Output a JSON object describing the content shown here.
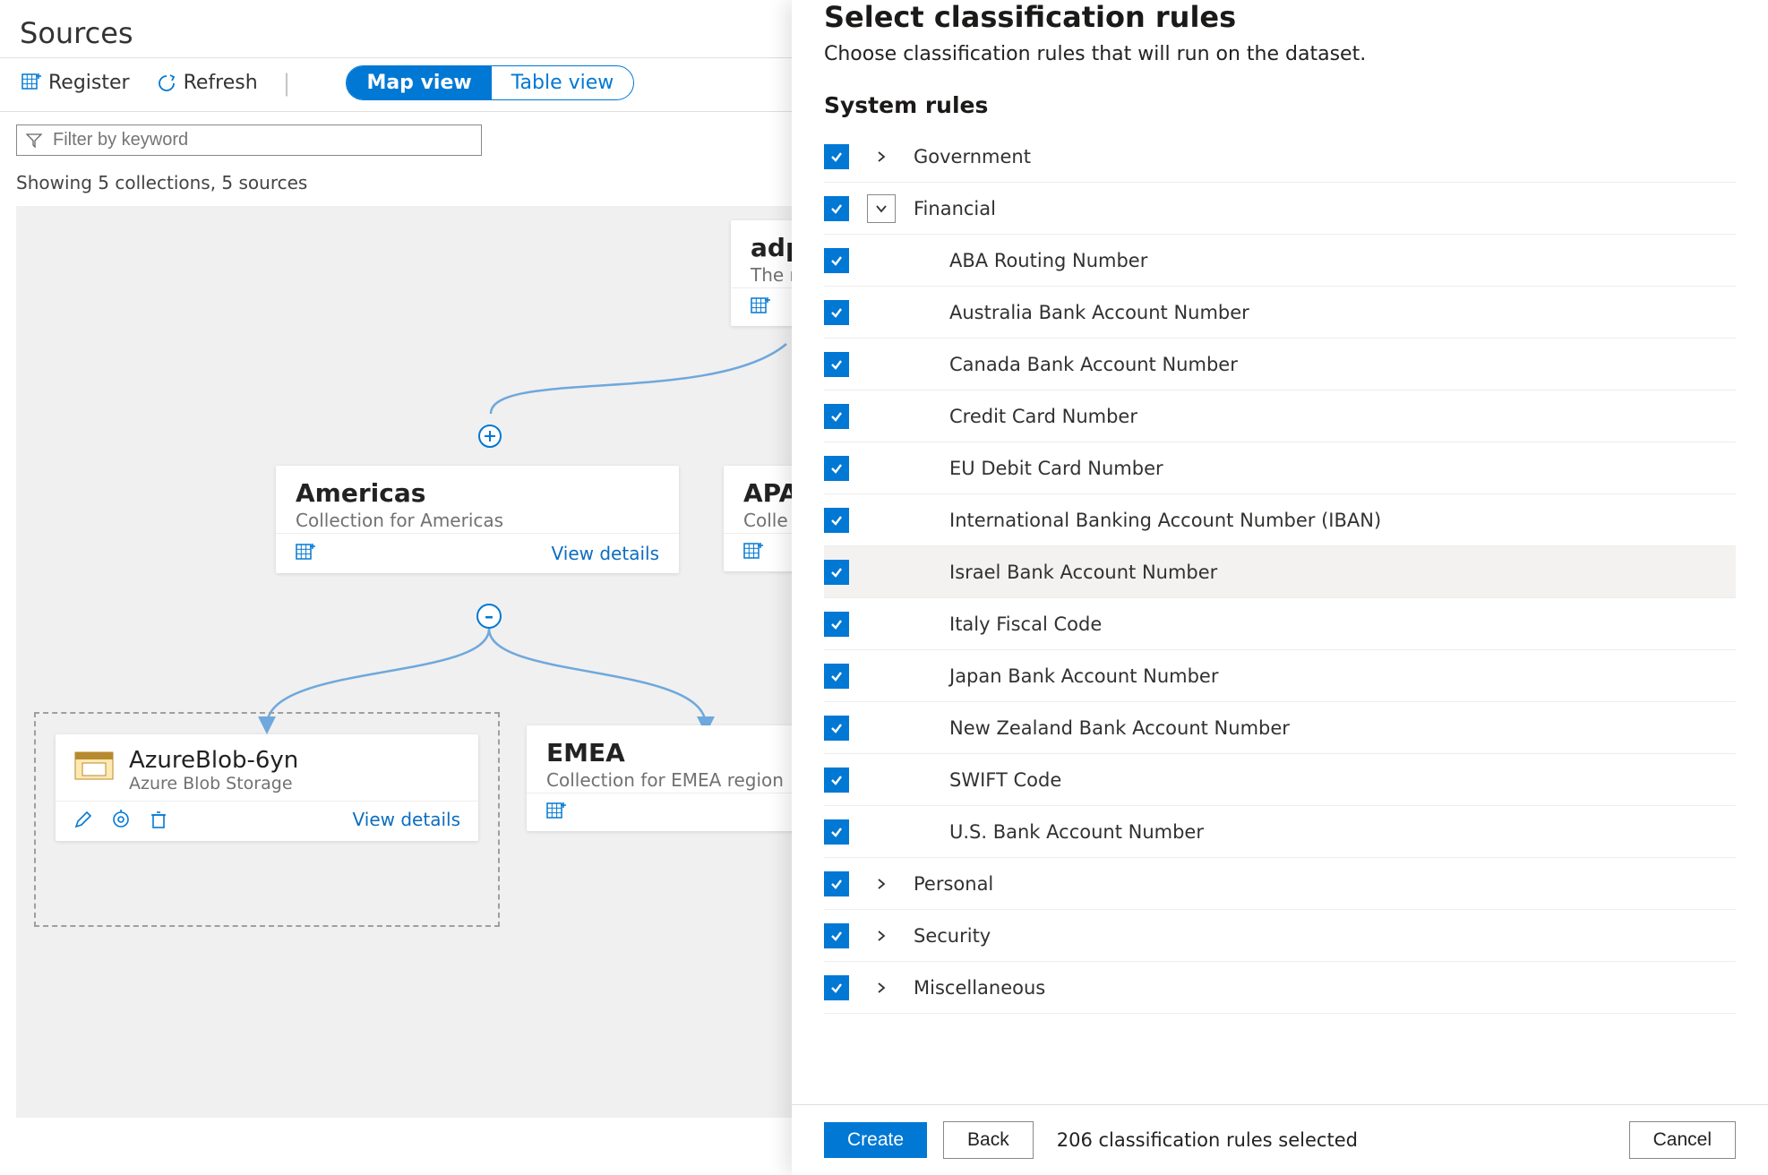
{
  "page": {
    "title": "Sources"
  },
  "toolbar": {
    "register_label": "Register",
    "refresh_label": "Refresh",
    "map_view_label": "Map view",
    "table_view_label": "Table view"
  },
  "filter": {
    "placeholder": "Filter by keyword"
  },
  "status": {
    "text": "Showing 5 collections, 5 sources"
  },
  "cards": {
    "root": {
      "title": "adpu",
      "subtitle": "The r"
    },
    "americas": {
      "title": "Americas",
      "subtitle": "Collection for Americas",
      "view_details": "View details"
    },
    "apac": {
      "title": "APA",
      "subtitle": "Colle"
    },
    "emea": {
      "title": "EMEA",
      "subtitle": "Collection for EMEA region"
    },
    "azureblob": {
      "title": "AzureBlob-6yn",
      "subtitle": "Azure Blob Storage",
      "view_details": "View details"
    }
  },
  "panel": {
    "title": "Select classification rules",
    "description": "Choose classification rules that will run on the dataset.",
    "system_rules_heading": "System rules",
    "categories": [
      {
        "name": "Government",
        "expanded": false
      },
      {
        "name": "Financial",
        "expanded": true,
        "children": [
          "ABA Routing Number",
          "Australia Bank Account Number",
          "Canada Bank Account Number",
          "Credit Card Number",
          "EU Debit Card Number",
          "International Banking Account Number (IBAN)",
          "Israel Bank Account Number",
          "Italy Fiscal Code",
          "Japan Bank Account Number",
          "New Zealand Bank Account Number",
          "SWIFT Code",
          "U.S. Bank Account Number"
        ],
        "highlight_index": 6
      },
      {
        "name": "Personal",
        "expanded": false
      },
      {
        "name": "Security",
        "expanded": false
      },
      {
        "name": "Miscellaneous",
        "expanded": false
      }
    ],
    "footer": {
      "create_label": "Create",
      "back_label": "Back",
      "cancel_label": "Cancel",
      "selected_text": "206 classification rules selected"
    }
  },
  "colors": {
    "primary": "#0078d4"
  }
}
